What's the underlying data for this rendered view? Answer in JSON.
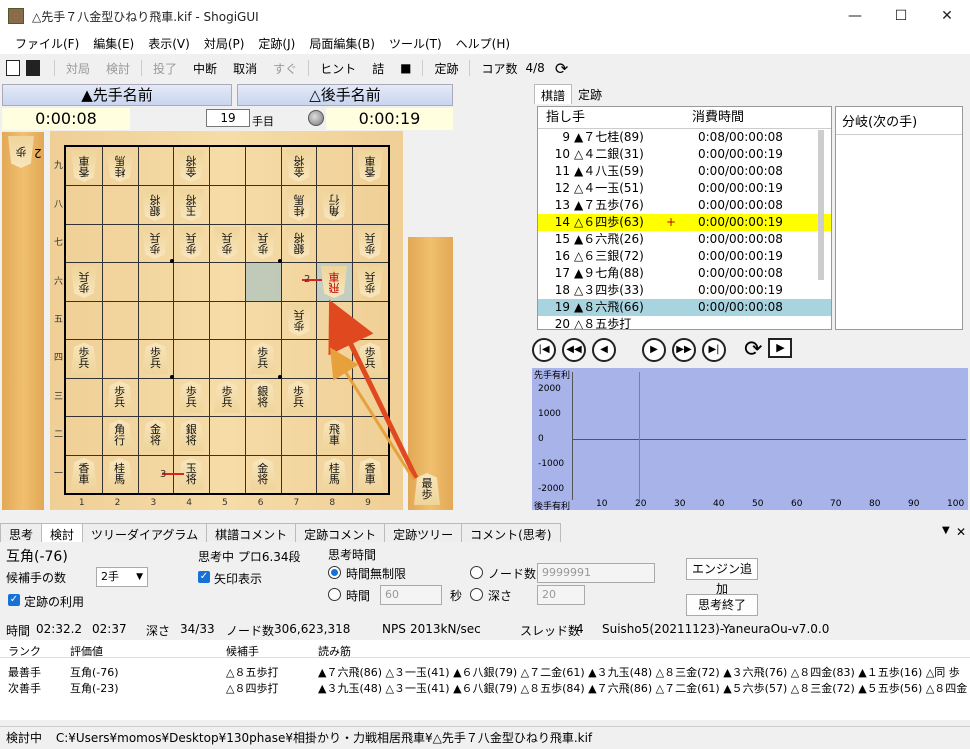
{
  "window": {
    "title": "△先手７八金型ひねり飛車.kif - ShogiGUI",
    "min": "—",
    "max": "☐",
    "close": "✕"
  },
  "menu": [
    "ファイル(F)",
    "編集(E)",
    "表示(V)",
    "対局(P)",
    "定跡(J)",
    "局面編集(B)",
    "ツール(T)",
    "ヘルプ(H)"
  ],
  "toolbar": {
    "items": [
      "対局",
      "検討",
      "投了",
      "中断",
      "取消",
      "すぐ",
      "ヒント",
      "詰",
      "■",
      "定跡"
    ],
    "cores_label": "コア数",
    "cores": "4/8"
  },
  "players": {
    "sente": "▲先手名前",
    "gote": "△後手名前",
    "sente_time": "0:00:08",
    "gote_time": "0:00:19",
    "move_number": "19",
    "move_unit": "手目"
  },
  "board": {
    "col_labels": [
      "1",
      "2",
      "3",
      "4",
      "5",
      "6",
      "7",
      "8",
      "9"
    ],
    "row_labels": [
      "九",
      "八",
      "七",
      "六",
      "五",
      "四",
      "三",
      "二",
      "一"
    ],
    "gote_hand": {
      "piece": "歩",
      "count": "2"
    },
    "sente_hand_label": "最",
    "sente_hand_piece": "歩",
    "pieces": [
      {
        "c": 0,
        "r": 0,
        "t": "香車",
        "g": true
      },
      {
        "c": 1,
        "r": 0,
        "t": "桂馬",
        "g": true
      },
      {
        "c": 3,
        "r": 0,
        "t": "金将",
        "g": true
      },
      {
        "c": 6,
        "r": 0,
        "t": "金将",
        "g": true
      },
      {
        "c": 8,
        "r": 0,
        "t": "香車",
        "g": true
      },
      {
        "c": 2,
        "r": 1,
        "t": "銀将",
        "g": true
      },
      {
        "c": 3,
        "r": 1,
        "t": "玉将",
        "g": true
      },
      {
        "c": 6,
        "r": 1,
        "t": "桂馬",
        "g": true
      },
      {
        "c": 7,
        "r": 1,
        "t": "角行",
        "g": true
      },
      {
        "c": 2,
        "r": 2,
        "t": "歩兵",
        "g": true
      },
      {
        "c": 3,
        "r": 2,
        "t": "歩兵",
        "g": true
      },
      {
        "c": 4,
        "r": 2,
        "t": "歩兵",
        "g": true
      },
      {
        "c": 5,
        "r": 2,
        "t": "歩兵",
        "g": true
      },
      {
        "c": 6,
        "r": 2,
        "t": "銀将",
        "g": true
      },
      {
        "c": 8,
        "r": 2,
        "t": "歩兵",
        "g": true
      },
      {
        "c": 0,
        "r": 3,
        "t": "歩兵",
        "g": true
      },
      {
        "c": 7,
        "r": 3,
        "t": "飛車",
        "g": true,
        "red": true
      },
      {
        "c": 8,
        "r": 3,
        "t": "歩兵",
        "g": true
      },
      {
        "c": 6,
        "r": 4,
        "t": "歩兵",
        "g": true
      },
      {
        "c": 0,
        "r": 5,
        "t": "歩兵",
        "g": false
      },
      {
        "c": 2,
        "r": 5,
        "t": "歩兵",
        "g": false
      },
      {
        "c": 5,
        "r": 5,
        "t": "歩兵",
        "g": false
      },
      {
        "c": 8,
        "r": 5,
        "t": "歩兵",
        "g": false
      },
      {
        "c": 1,
        "r": 6,
        "t": "歩兵",
        "g": false
      },
      {
        "c": 3,
        "r": 6,
        "t": "歩兵",
        "g": false
      },
      {
        "c": 4,
        "r": 6,
        "t": "歩兵",
        "g": false
      },
      {
        "c": 5,
        "r": 6,
        "t": "銀将",
        "g": false
      },
      {
        "c": 6,
        "r": 6,
        "t": "歩兵",
        "g": false
      },
      {
        "c": 1,
        "r": 7,
        "t": "角行",
        "g": false
      },
      {
        "c": 2,
        "r": 7,
        "t": "金将",
        "g": false
      },
      {
        "c": 3,
        "r": 7,
        "t": "銀将",
        "g": false
      },
      {
        "c": 7,
        "r": 7,
        "t": "飛車",
        "g": false
      },
      {
        "c": 0,
        "r": 8,
        "t": "香車",
        "g": false
      },
      {
        "c": 1,
        "r": 8,
        "t": "桂馬",
        "g": false
      },
      {
        "c": 3,
        "r": 8,
        "t": "玉将",
        "g": false
      },
      {
        "c": 5,
        "r": 8,
        "t": "金将",
        "g": false
      },
      {
        "c": 7,
        "r": 8,
        "t": "桂馬",
        "g": false
      },
      {
        "c": 8,
        "r": 8,
        "t": "香車",
        "g": false
      }
    ],
    "arrow_labels": [
      "2",
      "3"
    ]
  },
  "kifu": {
    "tabs": [
      "棋譜",
      "定跡"
    ],
    "headers": [
      "指し手",
      "消費時間"
    ],
    "rows": [
      {
        "n": "9",
        "m": "▲７七桂(89)",
        "mk": "",
        "t": "0:08/00:00:08"
      },
      {
        "n": "10",
        "m": "△４二銀(31)",
        "mk": "",
        "t": "0:00/00:00:19"
      },
      {
        "n": "11",
        "m": "▲４八玉(59)",
        "mk": "",
        "t": "0:00/00:00:08"
      },
      {
        "n": "12",
        "m": "△４一玉(51)",
        "mk": "",
        "t": "0:00/00:00:19"
      },
      {
        "n": "13",
        "m": "▲７五歩(76)",
        "mk": "",
        "t": "0:00/00:00:08"
      },
      {
        "n": "14",
        "m": "△６四歩(63)",
        "mk": "+",
        "t": "0:00/00:00:19",
        "hl": "#ffff00"
      },
      {
        "n": "15",
        "m": "▲６六飛(26)",
        "mk": "",
        "t": "0:00/00:00:08"
      },
      {
        "n": "16",
        "m": "△６三銀(72)",
        "mk": "",
        "t": "0:00/00:00:19"
      },
      {
        "n": "17",
        "m": "▲９七角(88)",
        "mk": "",
        "t": "0:00/00:00:08"
      },
      {
        "n": "18",
        "m": "△３四歩(33)",
        "mk": "",
        "t": "0:00/00:00:19"
      },
      {
        "n": "19",
        "m": "▲８六飛(66)",
        "mk": "",
        "t": "0:00/00:00:08",
        "hl": "#a8d4e0"
      },
      {
        "n": "20",
        "m": "△８五歩打",
        "mk": "",
        "t": ""
      }
    ],
    "branch_header": "分岐(次の手)"
  },
  "graph": {
    "top_label": "先手有利",
    "bottom_label": "後手有利",
    "y_ticks": [
      "2000",
      "1000",
      "0",
      "-1000",
      "-2000"
    ],
    "x_ticks": [
      "10",
      "20",
      "30",
      "40",
      "50",
      "60",
      "70",
      "80",
      "90",
      "100"
    ]
  },
  "bottom": {
    "tabs": [
      "思考",
      "検討",
      "ツリーダイアグラム",
      "棋譜コメント",
      "定跡コメント",
      "定跡ツリー",
      "コメント(思考)"
    ],
    "eval": "互角(-76)",
    "thinking": "思考中 プロ6.34段",
    "cand_count_label": "候補手の数",
    "cand_count": "2手",
    "arrows_label": "矢印表示",
    "book_label": "定跡の利用",
    "time_group": "思考時間",
    "unlimited": "時間無制限",
    "time_label": "時間",
    "time_value": "60",
    "sec": "秒",
    "nodes_label": "ノード数",
    "nodes_value": "9999991",
    "depth_label": "深さ",
    "depth_value": "20",
    "add_engine": "エンジン追加",
    "stop": "思考終了",
    "info": {
      "time_label": "時間",
      "time": "02:32.2",
      "time2": "02:37",
      "depth_label": "深さ",
      "depth": "34/33",
      "nodes_label": "ノード数",
      "nodes": "306,623,318",
      "nps_label": "NPS",
      "nps": "2013kN/sec",
      "thread_label": "スレッド数",
      "threads": "4",
      "engine": "Suisho5(20211123)-YaneuraOu-v7.0.0"
    },
    "cand_headers": [
      "ランク",
      "評価値",
      "候補手",
      "読み筋"
    ],
    "candidates": [
      {
        "rank": "最善手",
        "val": "互角(-76)",
        "move": "△８五歩打",
        "pv": "▲７六飛(86) △３一玉(41) ▲６八銀(79) △７二金(61) ▲３九玉(48) △８三金(72) ▲３六飛(76) △８四金(83) ▲１五歩(16) △同 歩"
      },
      {
        "rank": "次善手",
        "val": "互角(-23)",
        "move": "△８四歩打",
        "pv": "▲３九玉(48) △３一玉(41) ▲６八銀(79) △８五歩(84) ▲７六飛(86) △７二金(61) ▲５六歩(57) △８三金(72) ▲５五歩(56) △８四金"
      }
    ]
  },
  "status": {
    "mode": "検討中",
    "path": "C:¥Users¥momos¥Desktop¥130phase¥相掛かり・力戦相居飛車¥△先手７八金型ひねり飛車.kif"
  }
}
